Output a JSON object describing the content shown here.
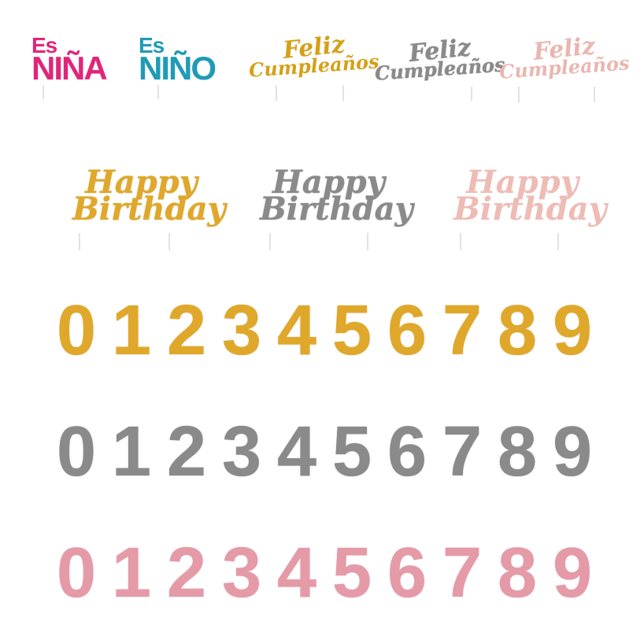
{
  "top_row": {
    "es_nina": {
      "line1": "Es",
      "line2": "NIÑA",
      "color": "#e0267a"
    },
    "es_nino": {
      "line1": "Es",
      "line2": "NIÑO",
      "color": "#1f9bb6"
    },
    "feliz_gold": {
      "line1": "Feliz",
      "line2": "Cumpleaños",
      "color": "#d4a017"
    },
    "feliz_silver": {
      "line1": "Feliz",
      "line2": "Cumpleaños",
      "color": "#8a8a8a"
    },
    "feliz_rose": {
      "line1": "Feliz",
      "line2": "Cumpleaños",
      "color": "#eab6b0"
    }
  },
  "happy_birthday": {
    "gold": {
      "line1": "Happy",
      "line2": "Birthday",
      "color": "#e0a82a"
    },
    "silver": {
      "line1": "Happy",
      "line2": "Birthday",
      "color": "#8a8a8a"
    },
    "rose": {
      "line1": "Happy",
      "line2": "Birthday",
      "color": "#eebbb5"
    }
  },
  "number_rows": {
    "gold": [
      "0",
      "1",
      "2",
      "3",
      "4",
      "5",
      "6",
      "7",
      "8",
      "9"
    ],
    "silver": [
      "0",
      "1",
      "2",
      "3",
      "4",
      "5",
      "6",
      "7",
      "8",
      "9"
    ],
    "rose": [
      "0",
      "1",
      "2",
      "3",
      "4",
      "5",
      "6",
      "7",
      "8",
      "9"
    ]
  },
  "colors": {
    "gold": "#e0a82a",
    "silver": "#8a8a8a",
    "rose": "#e59aa8"
  }
}
